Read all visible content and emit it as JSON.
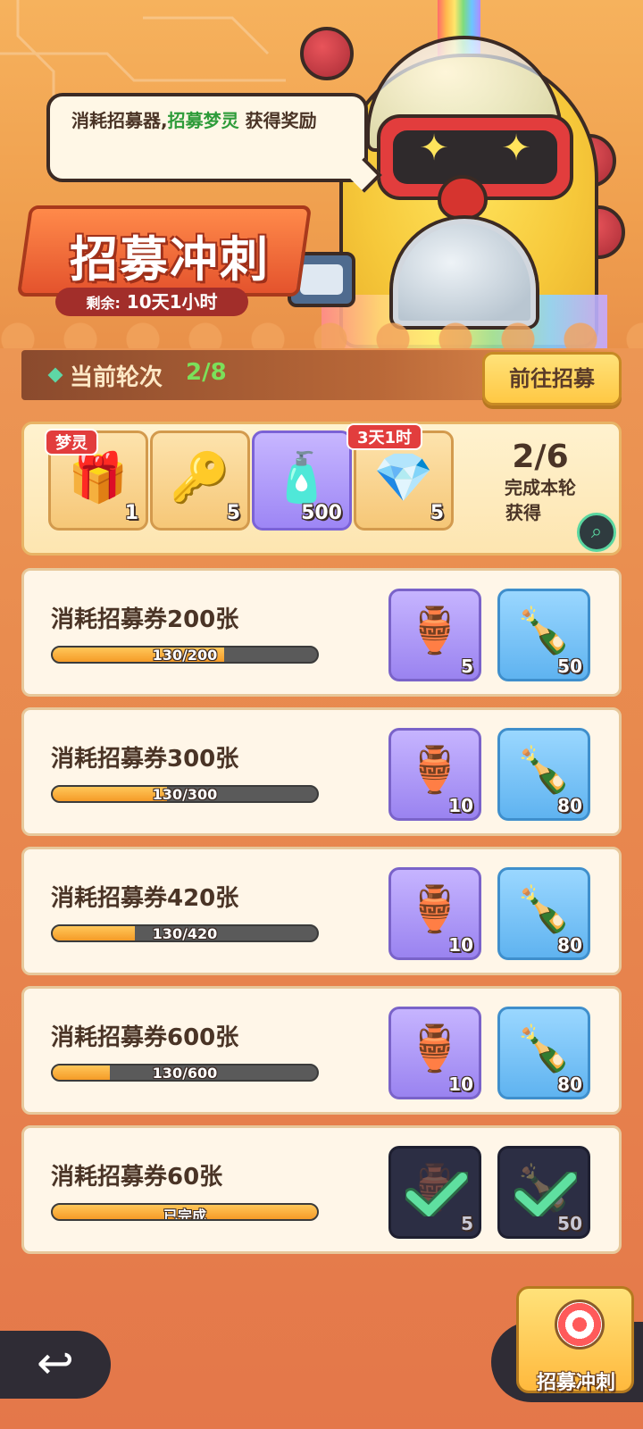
{
  "banner": {
    "speech_prefix": "消耗招募器,",
    "speech_highlight": "招募梦灵",
    "speech_suffix": " 获得奖励",
    "title": "招募冲刺",
    "remaining_label": "剩余:",
    "remaining_value": " 10天1小时"
  },
  "round": {
    "label": "当前轮次",
    "value": "2/8",
    "goto_button": "前往招募"
  },
  "round_rewards": {
    "items": [
      {
        "icon": "mystery-chest-icon",
        "glyph": "🎁",
        "count": "1",
        "tag": "梦灵"
      },
      {
        "icon": "star-key-icon",
        "glyph": "🔑",
        "count": "5"
      },
      {
        "icon": "rainbow-bottle-icon",
        "glyph": "🧴",
        "count": "500"
      },
      {
        "icon": "crystal-ring-icon",
        "glyph": "💎",
        "count": "5",
        "tag": "3天1时"
      }
    ],
    "progress": "2/6",
    "progress_line1": "完成本轮",
    "progress_line2": "获得",
    "magnifier_icon": "magnifier-icon"
  },
  "tasks": [
    {
      "name": "消耗招募券200张",
      "progress_text": "130/200",
      "current": 130,
      "target": 200,
      "rewards": [
        {
          "icon": "capsule-machine-icon",
          "count": "5"
        },
        {
          "icon": "mystery-bottle-icon",
          "count": "50"
        }
      ]
    },
    {
      "name": "消耗招募券300张",
      "progress_text": "130/300",
      "current": 130,
      "target": 300,
      "rewards": [
        {
          "icon": "capsule-machine-icon",
          "count": "10"
        },
        {
          "icon": "mystery-bottle-icon",
          "count": "80"
        }
      ]
    },
    {
      "name": "消耗招募券420张",
      "progress_text": "130/420",
      "current": 130,
      "target": 420,
      "rewards": [
        {
          "icon": "capsule-machine-icon",
          "count": "10"
        },
        {
          "icon": "mystery-bottle-icon",
          "count": "80"
        }
      ]
    },
    {
      "name": "消耗招募券600张",
      "progress_text": "130/600",
      "current": 130,
      "target": 600,
      "rewards": [
        {
          "icon": "capsule-machine-icon",
          "count": "10"
        },
        {
          "icon": "mystery-bottle-icon",
          "count": "80"
        }
      ]
    },
    {
      "name": "消耗招募券60张",
      "progress_text": "已完成",
      "current": 60,
      "target": 60,
      "completed": true,
      "rewards": [
        {
          "icon": "capsule-machine-icon",
          "count": "5"
        },
        {
          "icon": "mystery-bottle-icon",
          "count": "50"
        }
      ]
    }
  ],
  "bottom": {
    "back_icon": "back-arrow-icon",
    "sprint_label": "招募冲刺"
  }
}
